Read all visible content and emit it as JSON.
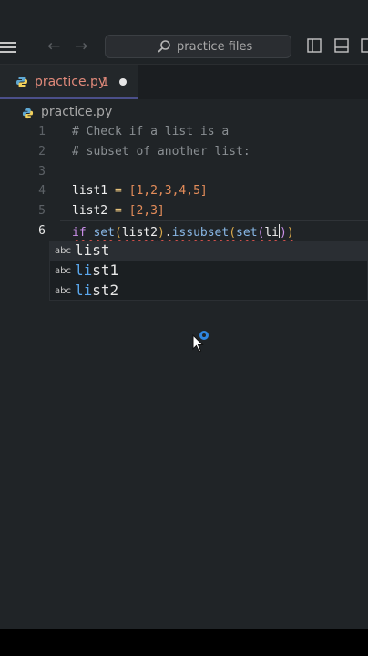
{
  "search": {
    "placeholder": "practice files"
  },
  "tab": {
    "label": "practice.py",
    "badge": "1"
  },
  "breadcrumb": {
    "file": "practice.py"
  },
  "editor": {
    "line_numbers": [
      "1",
      "2",
      "3",
      "4",
      "5",
      "6"
    ],
    "lines": {
      "l1": "# Check if a list is a",
      "l2": "# subset of another list:",
      "l4_var": "list1",
      "l4_op": " = ",
      "l4_val": "[1,2,3,4,5]",
      "l5_var": "list2",
      "l5_op": " = ",
      "l5_val": "[2,3]",
      "l6_kw": "if",
      "l6_fn1": "set",
      "l6_p1": "(",
      "l6_arg": "list2",
      "l6_p2": ")",
      "l6_dot": ".",
      "l6_fn2": "issubset",
      "l6_p3": "(",
      "l6_fn3": "set",
      "l6_p4": "(",
      "l6_typed": "li",
      "l6_p5": ")",
      "l6_p6": ")"
    }
  },
  "suggestions": [
    {
      "kind": "abc",
      "match": "li",
      "rest": "st"
    },
    {
      "kind": "abc",
      "match": "li",
      "rest": "st1"
    },
    {
      "kind": "abc",
      "match": "li",
      "rest": "st2"
    }
  ],
  "colors": {
    "accent": "#2f86e0",
    "error": "#e0544f",
    "tab_modified": "#e0897a"
  }
}
